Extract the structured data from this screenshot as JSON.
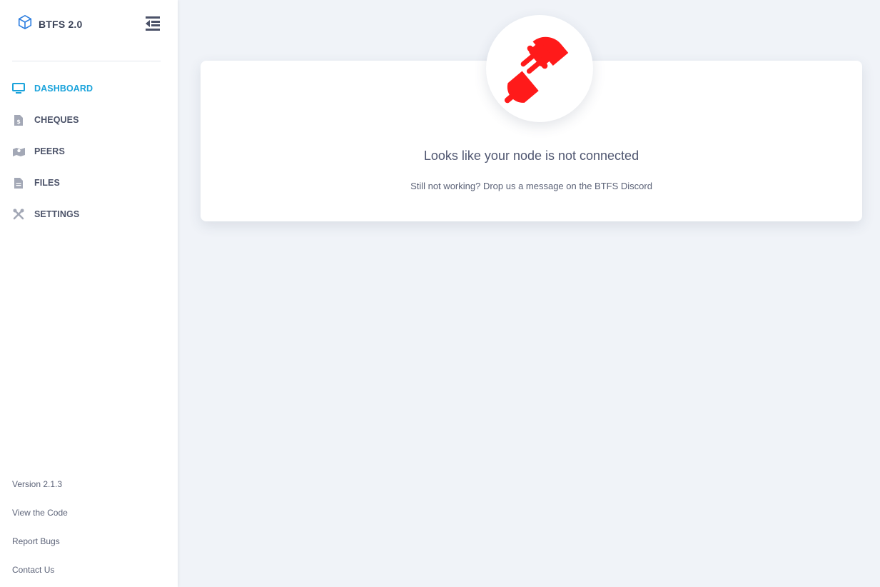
{
  "brand": {
    "title": "BTFS 2.0",
    "icon": "cube-icon"
  },
  "sidebar": {
    "items": [
      {
        "label": "DASHBOARD",
        "icon": "monitor-icon",
        "active": true
      },
      {
        "label": "CHEQUES",
        "icon": "cheque-file-icon",
        "active": false
      },
      {
        "label": "PEERS",
        "icon": "map-icon",
        "active": false
      },
      {
        "label": "FILES",
        "icon": "file-icon",
        "active": false
      },
      {
        "label": "SETTINGS",
        "icon": "tools-icon",
        "active": false
      }
    ],
    "footer": {
      "version": "Version 2.1.3",
      "view_code": "View the Code",
      "report_bugs": "Report Bugs",
      "contact_us": "Contact Us"
    }
  },
  "main": {
    "status_icon": "disconnected-plug-icon",
    "title": "Looks like your node is not connected",
    "subtitle": "Still not working? Drop us a message on the BTFS Discord"
  },
  "colors": {
    "accent": "#1aa3db",
    "plug": "#ff1a1a",
    "background": "#f0f3f8",
    "text": "#4f5670"
  }
}
